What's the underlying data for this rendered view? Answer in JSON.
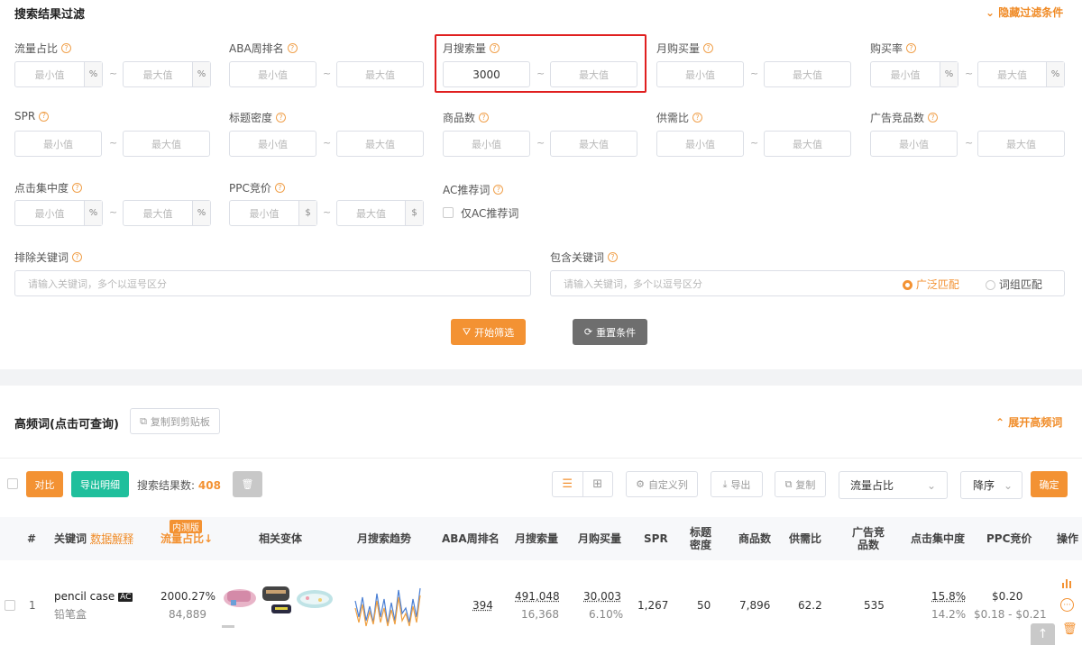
{
  "filter": {
    "title": "搜索结果过滤",
    "hide_label": "隐藏过滤条件",
    "min_ph": "最小值",
    "max_ph": "最大值",
    "dash": "~",
    "pct": "%",
    "usd": "$",
    "traffic": "流量占比",
    "aba": "ABA周排名",
    "monthly_search": "月搜索量",
    "monthly_search_min": "3000",
    "monthly_buy": "月购买量",
    "buy_rate": "购买率",
    "spr": "SPR",
    "title_density": "标题密度",
    "products": "商品数",
    "supply_demand": "供需比",
    "ad_products": "广告竞品数",
    "click_conc": "点击集中度",
    "ppc": "PPC竞价",
    "ac_label": "AC推荐词",
    "ac_only": "仅AC推荐词",
    "exclude_label": "排除关键词",
    "exclude_ph": "请输入关键词，多个以逗号区分",
    "include_label": "包含关键词",
    "include_ph": "请输入关键词，多个以逗号区分",
    "broad": "广泛匹配",
    "phrase": "词组匹配",
    "start_btn": "开始筛选",
    "reset_btn": "重置条件"
  },
  "hf": {
    "title": "高频词(点击可查询)",
    "copy_btn": "复制到剪贴板",
    "expand": "展开高频词"
  },
  "toolbar": {
    "compare": "对比",
    "export_detail": "导出明细",
    "count_label": "搜索结果数:",
    "count": "408",
    "custom_cols": "自定义列",
    "export": "导出",
    "copy": "复制",
    "sort_field": "流量占比",
    "sort_order": "降序",
    "confirm": "确定"
  },
  "table": {
    "h_idx": "#",
    "h_kw": "关键词",
    "h_explain": "数据解释",
    "h_beta": "内测版",
    "h_traffic": "流量占比↓",
    "h_variants": "相关变体",
    "h_trend": "月搜索趋势",
    "h_aba": "ABA周排名",
    "h_search": "月搜索量",
    "h_buy": "月购买量",
    "h_spr": "SPR",
    "h_density": "标题密度",
    "h_products": "商品数",
    "h_sd": "供需比",
    "h_ad": "广告竞品数",
    "h_click": "点击集中度",
    "h_ppc": "PPC竞价",
    "h_ops": "操作",
    "rows": [
      {
        "idx": "1",
        "kw": "pencil case",
        "ac": "AC",
        "kw_cn": "铅笔盒",
        "traffic": "2000.27%",
        "traffic_sub": "84,889",
        "aba": "394",
        "search": "491,048",
        "search_sub": "16,368",
        "buy": "30,003",
        "buy_sub": "6.10%",
        "spr": "1,267",
        "density": "50",
        "products": "7,896",
        "sd": "62.2",
        "ad": "535",
        "click": "15.8%",
        "click_sub": "14.2%",
        "ppc": "$0.20",
        "ppc_sub": "$0.18 - $0.21"
      }
    ]
  },
  "colors": {
    "accent": "#f39233",
    "teal": "#1fbf9c",
    "highlight_box": "#e02020"
  }
}
